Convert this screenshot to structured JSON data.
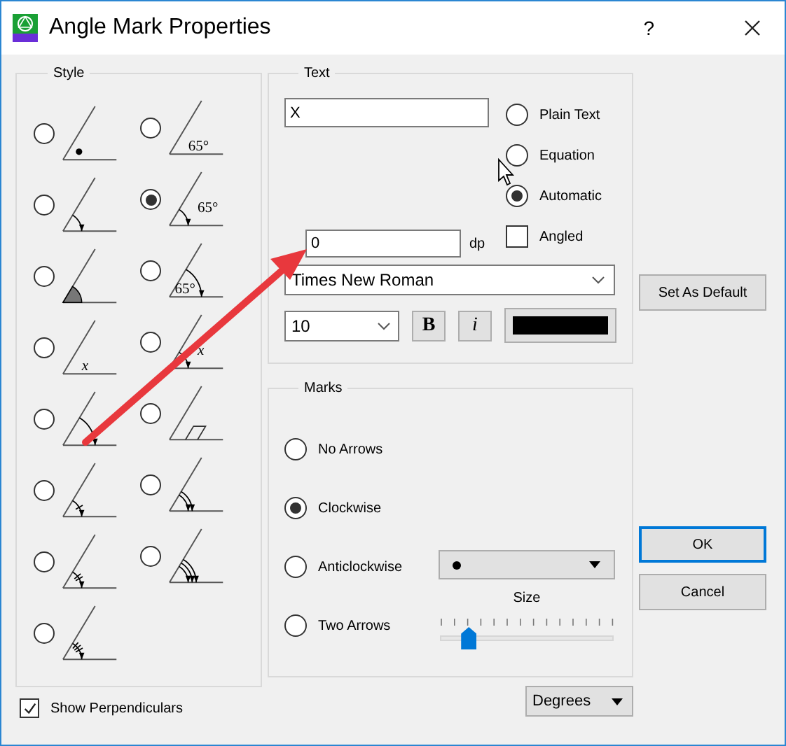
{
  "window": {
    "title": "Angle Mark Properties",
    "help": "?"
  },
  "style": {
    "title": "Style",
    "options": [
      {
        "kind": "dot",
        "selected": false
      },
      {
        "kind": "text",
        "label": "65°",
        "selected": false
      },
      {
        "kind": "arc",
        "selected": false
      },
      {
        "kind": "arc",
        "label": "65°",
        "selected": true
      },
      {
        "kind": "sector",
        "selected": false
      },
      {
        "kind": "big_arc",
        "label": "65°",
        "selected": false
      },
      {
        "kind": "text",
        "label": "x",
        "italic": true,
        "selected": false
      },
      {
        "kind": "arc",
        "label": "x",
        "italic": true,
        "selected": false
      },
      {
        "kind": "big_arc",
        "selected": false
      },
      {
        "kind": "right_angle",
        "selected": false
      },
      {
        "kind": "one_tick",
        "selected": false
      },
      {
        "kind": "double_arc",
        "selected": false
      },
      {
        "kind": "two_ticks",
        "selected": false
      },
      {
        "kind": "triple_arc",
        "selected": false
      },
      {
        "kind": "three_ticks",
        "selected": false
      }
    ]
  },
  "show_perpendiculars": {
    "label": "Show Perpendiculars",
    "checked": true
  },
  "text": {
    "title": "Text",
    "value": "X",
    "modes": [
      {
        "label": "Plain Text",
        "selected": false
      },
      {
        "label": "Equation",
        "selected": false
      },
      {
        "label": "Automatic",
        "selected": true
      }
    ],
    "angled": {
      "label": "Angled",
      "checked": false
    },
    "decimals": {
      "value": "0",
      "unit": "dp"
    },
    "font": "Times New Roman",
    "size": "10",
    "bold": "B",
    "italic": "i"
  },
  "set_default": "Set As Default",
  "marks": {
    "title": "Marks",
    "arrows": [
      {
        "label": "No Arrows",
        "selected": false
      },
      {
        "label": "Clockwise",
        "selected": true
      },
      {
        "label": "Anticlockwise",
        "selected": false
      },
      {
        "label": "Two Arrows",
        "selected": false
      }
    ],
    "size": {
      "label": "Size",
      "level": 0.13
    }
  },
  "units": "Degrees",
  "buttons": {
    "ok": "OK",
    "cancel": "Cancel"
  }
}
